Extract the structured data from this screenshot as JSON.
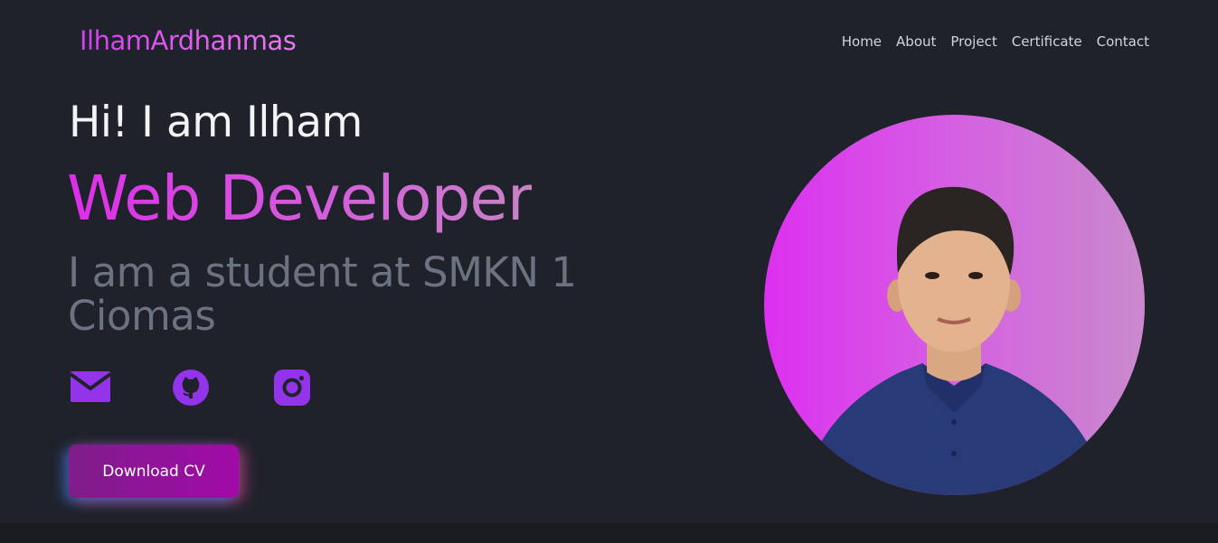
{
  "header": {
    "logo": "IlhamArdhanmas",
    "nav": [
      "Home",
      "About",
      "Project",
      "Certificate",
      "Contact"
    ]
  },
  "hero": {
    "greeting": "Hi! I am Ilham",
    "role": "Web Developer",
    "subtitle": "I am a student at SMKN 1 Ciomas",
    "socials": [
      {
        "name": "email",
        "icon": "mail-icon"
      },
      {
        "name": "github",
        "icon": "github-icon"
      },
      {
        "name": "instagram",
        "icon": "instagram-icon"
      }
    ],
    "cv_button": "Download CV"
  },
  "colors": {
    "background": "#1f222b",
    "accent": "#d53cf0",
    "icon": "#9333ea",
    "subtitle": "#6b7280"
  }
}
